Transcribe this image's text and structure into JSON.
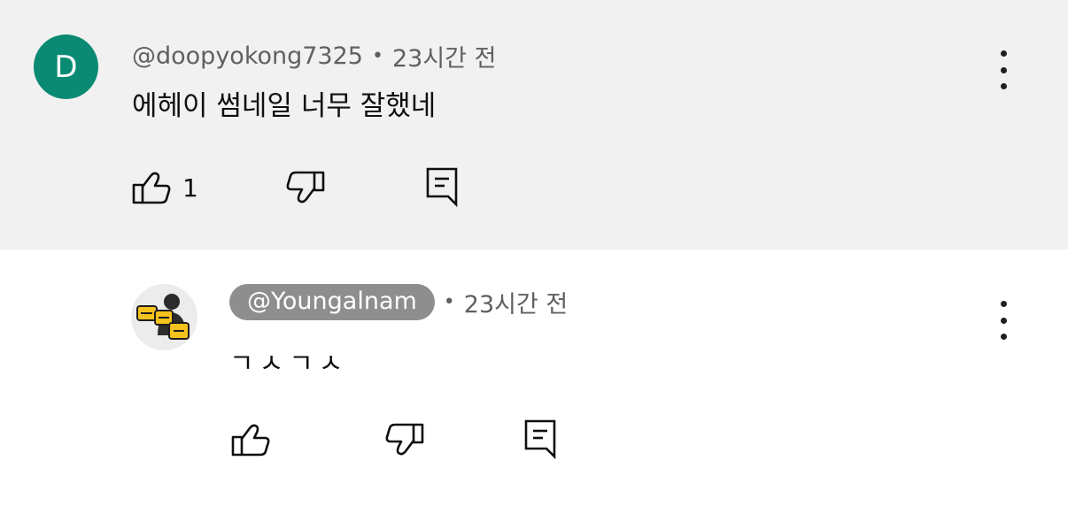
{
  "comments": [
    {
      "avatar_letter": "D",
      "author": "@doopyokong7325",
      "separator": "•",
      "time": "23시간 전",
      "text": "에헤이 썸네일 너무 잘했네",
      "like_count": "1"
    },
    {
      "avatar_alt": "영알남",
      "author": "@Youngalnam",
      "separator": "•",
      "time": "23시간 전",
      "text": "ㄱㅅㄱㅅ",
      "like_count": ""
    }
  ],
  "colors": {
    "highlight_background": "#f1f1f1",
    "avatar_d": "#0a8a73",
    "author_badge": "#8e8e8e",
    "meta_text": "#606060"
  },
  "icons": {
    "like": "thumbs-up-icon",
    "dislike": "thumbs-down-icon",
    "reply": "comment-reply-icon",
    "more": "more-vert-icon"
  }
}
